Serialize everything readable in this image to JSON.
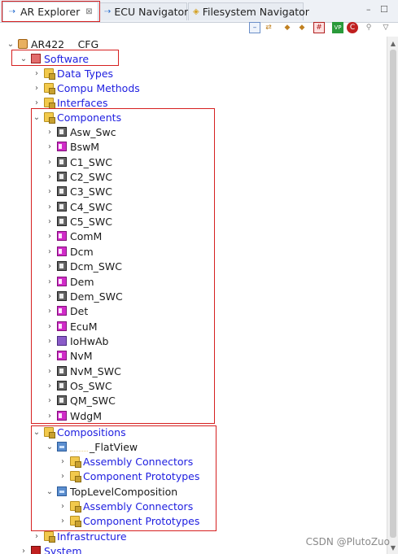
{
  "tabs": [
    {
      "label": "AR Explorer",
      "close": "⊠",
      "icon": "ar-explorer-icon"
    },
    {
      "label": "ECU Navigator",
      "icon": "ecu-navigator-icon"
    },
    {
      "label": "Filesystem Navigator",
      "icon": "filesystem-icon"
    }
  ],
  "window_buttons": {
    "minimize": "–",
    "maximize": "☐"
  },
  "toolbar_icons": [
    "collapse-all-icon",
    "link-editor-icon",
    "filter-icon",
    "filter-2-icon",
    "grid-icon",
    "vp-icon",
    "refresh-icon",
    "pin-icon"
  ],
  "tree": {
    "root": "AR422_        _CFG",
    "software": "Software",
    "data_types": "Data Types",
    "compu_methods": "Compu Methods",
    "interfaces": "Interfaces",
    "components": "Components",
    "component_items": [
      "Asw_Swc",
      "BswM",
      "C1_SWC",
      "C2_SWC",
      "C3_SWC",
      "C4_SWC",
      "C5_SWC",
      "ComM",
      "Dcm",
      "Dcm_SWC",
      "Dem",
      "Dem_SWC",
      "Det",
      "EcuM",
      "IoHwAb",
      "NvM",
      "NvM_SWC",
      "Os_SWC",
      "QM_SWC",
      "WdgM"
    ],
    "component_types": [
      "swc",
      "bsw",
      "swc",
      "swc",
      "swc",
      "swc",
      "swc",
      "bsw",
      "bsw",
      "swc",
      "bsw",
      "swc",
      "bsw",
      "bsw",
      "io",
      "bsw",
      "swc",
      "swc",
      "swc",
      "bsw"
    ],
    "compositions": "Compositions",
    "flatview": "_FlatView",
    "assembly_connectors": "Assembly Connectors",
    "component_prototypes": "Component Prototypes",
    "top_level": "TopLevelComposition",
    "infrastructure": "Infrastructure",
    "system": "System"
  },
  "watermark": "CSDN @PlutoZuo",
  "colors": {
    "link": "#2020e0",
    "annotation": "#d62020"
  }
}
